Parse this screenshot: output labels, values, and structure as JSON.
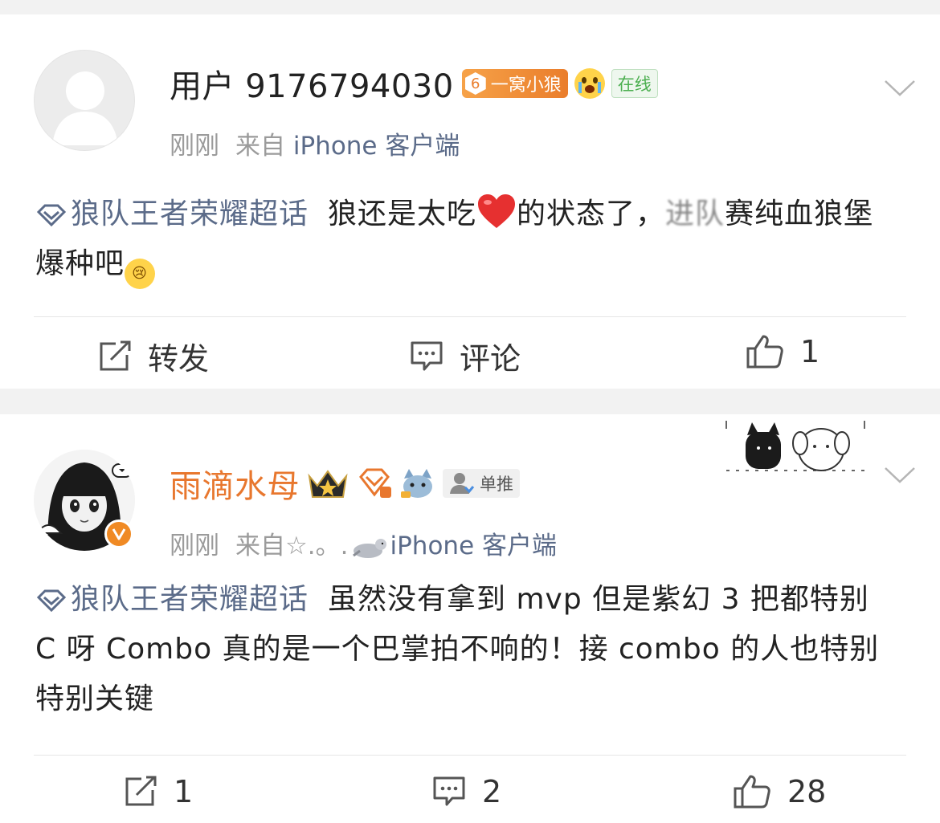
{
  "posts": [
    {
      "username": "用户 9176794030",
      "fan_level": "6",
      "fan_badge_label": "一窝小狼",
      "online_label": "在线",
      "time": "刚刚",
      "source_prefix": "来自",
      "source_client": "iPhone 客户端",
      "topic": "狼队王者荣耀超话",
      "text_part1": "狼还是太吃",
      "text_part2": "的状态了，",
      "text_blurred": "进队",
      "text_part3": "赛纯血狼堡爆种吧",
      "actions": {
        "repost_label": "转发",
        "comment_label": "评论",
        "like_count": "1"
      }
    },
    {
      "username": "雨滴水母",
      "dan_label": "单推",
      "time": "刚刚",
      "source_prefix": "来自☆.。.",
      "source_client": "iPhone 客户端",
      "topic": "狼队王者荣耀超话",
      "text": "虽然没有拿到 mvp 但是紫幻 3 把都特别 C 呀 Combo 真的是一个巴掌拍不响的！接 combo 的人也特别特别关键",
      "actions": {
        "repost_count": "1",
        "comment_count": "2",
        "like_count": "28"
      }
    }
  ],
  "colors": {
    "link": "#5b6b89",
    "orange_name": "#e8772e",
    "online_green": "#4caf50"
  }
}
